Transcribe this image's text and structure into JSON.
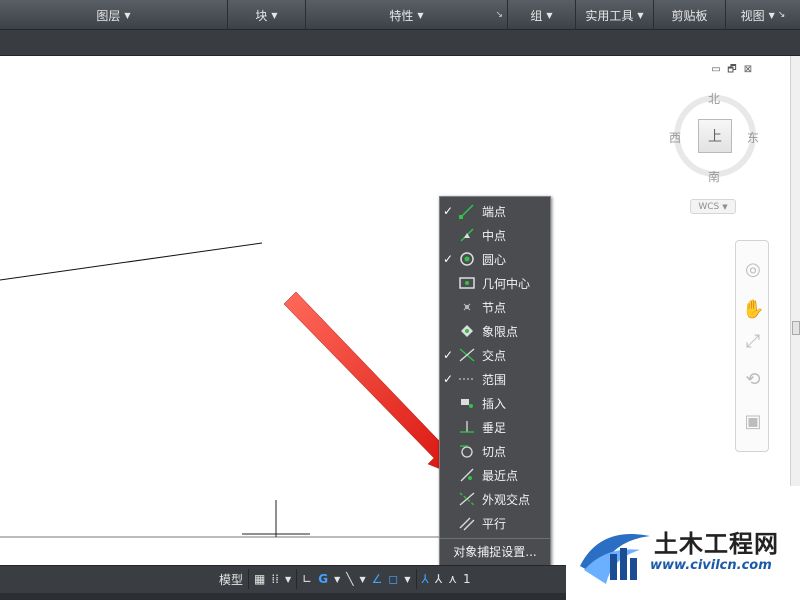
{
  "ribbon": {
    "sections": [
      {
        "label": "图层",
        "caret": true
      },
      {
        "label": "块",
        "caret": true
      },
      {
        "label": "特性",
        "caret": true
      },
      {
        "label": "组",
        "caret": true
      },
      {
        "label": "实用工具",
        "caret": true
      },
      {
        "label": "剪贴板",
        "caret": false
      },
      {
        "label": "视图",
        "caret": true
      }
    ],
    "dialog_launcher": "↘"
  },
  "viewport_controls": {
    "minimize": "▭",
    "restore": "🗗",
    "close": "⊠"
  },
  "viewcube": {
    "north": "北",
    "south": "南",
    "east": "东",
    "west": "西",
    "face": "上"
  },
  "wcs": "WCS",
  "snap_menu": {
    "items": [
      {
        "label": "端点",
        "checked": true,
        "icon": "endpoint-icon"
      },
      {
        "label": "中点",
        "checked": false,
        "icon": "midpoint-icon"
      },
      {
        "label": "圆心",
        "checked": true,
        "icon": "center-icon"
      },
      {
        "label": "几何中心",
        "checked": false,
        "icon": "geometric-center-icon"
      },
      {
        "label": "节点",
        "checked": false,
        "icon": "node-icon"
      },
      {
        "label": "象限点",
        "checked": false,
        "icon": "quadrant-icon"
      },
      {
        "label": "交点",
        "checked": true,
        "icon": "intersection-icon"
      },
      {
        "label": "范围",
        "checked": true,
        "icon": "extension-icon"
      },
      {
        "label": "插入",
        "checked": false,
        "icon": "insertion-icon"
      },
      {
        "label": "垂足",
        "checked": false,
        "icon": "perpendicular-icon"
      },
      {
        "label": "切点",
        "checked": false,
        "icon": "tangent-icon"
      },
      {
        "label": "最近点",
        "checked": false,
        "icon": "nearest-icon"
      },
      {
        "label": "外观交点",
        "checked": false,
        "icon": "apparent-intersection-icon"
      },
      {
        "label": "平行",
        "checked": false,
        "icon": "parallel-icon"
      }
    ],
    "settings_label": "对象捕捉设置..."
  },
  "statusbar": {
    "model_label": "模型",
    "trailing_text": "1"
  },
  "watermark": {
    "title": "土木工程网",
    "url": "www.civilcn.com"
  },
  "colors": {
    "menu_bg": "#4a4c4f",
    "ribbon_bg": "#45494f",
    "arrow": "#e0201a",
    "snap_green": "#2ec44a",
    "status_blue": "#3fa3ff"
  }
}
